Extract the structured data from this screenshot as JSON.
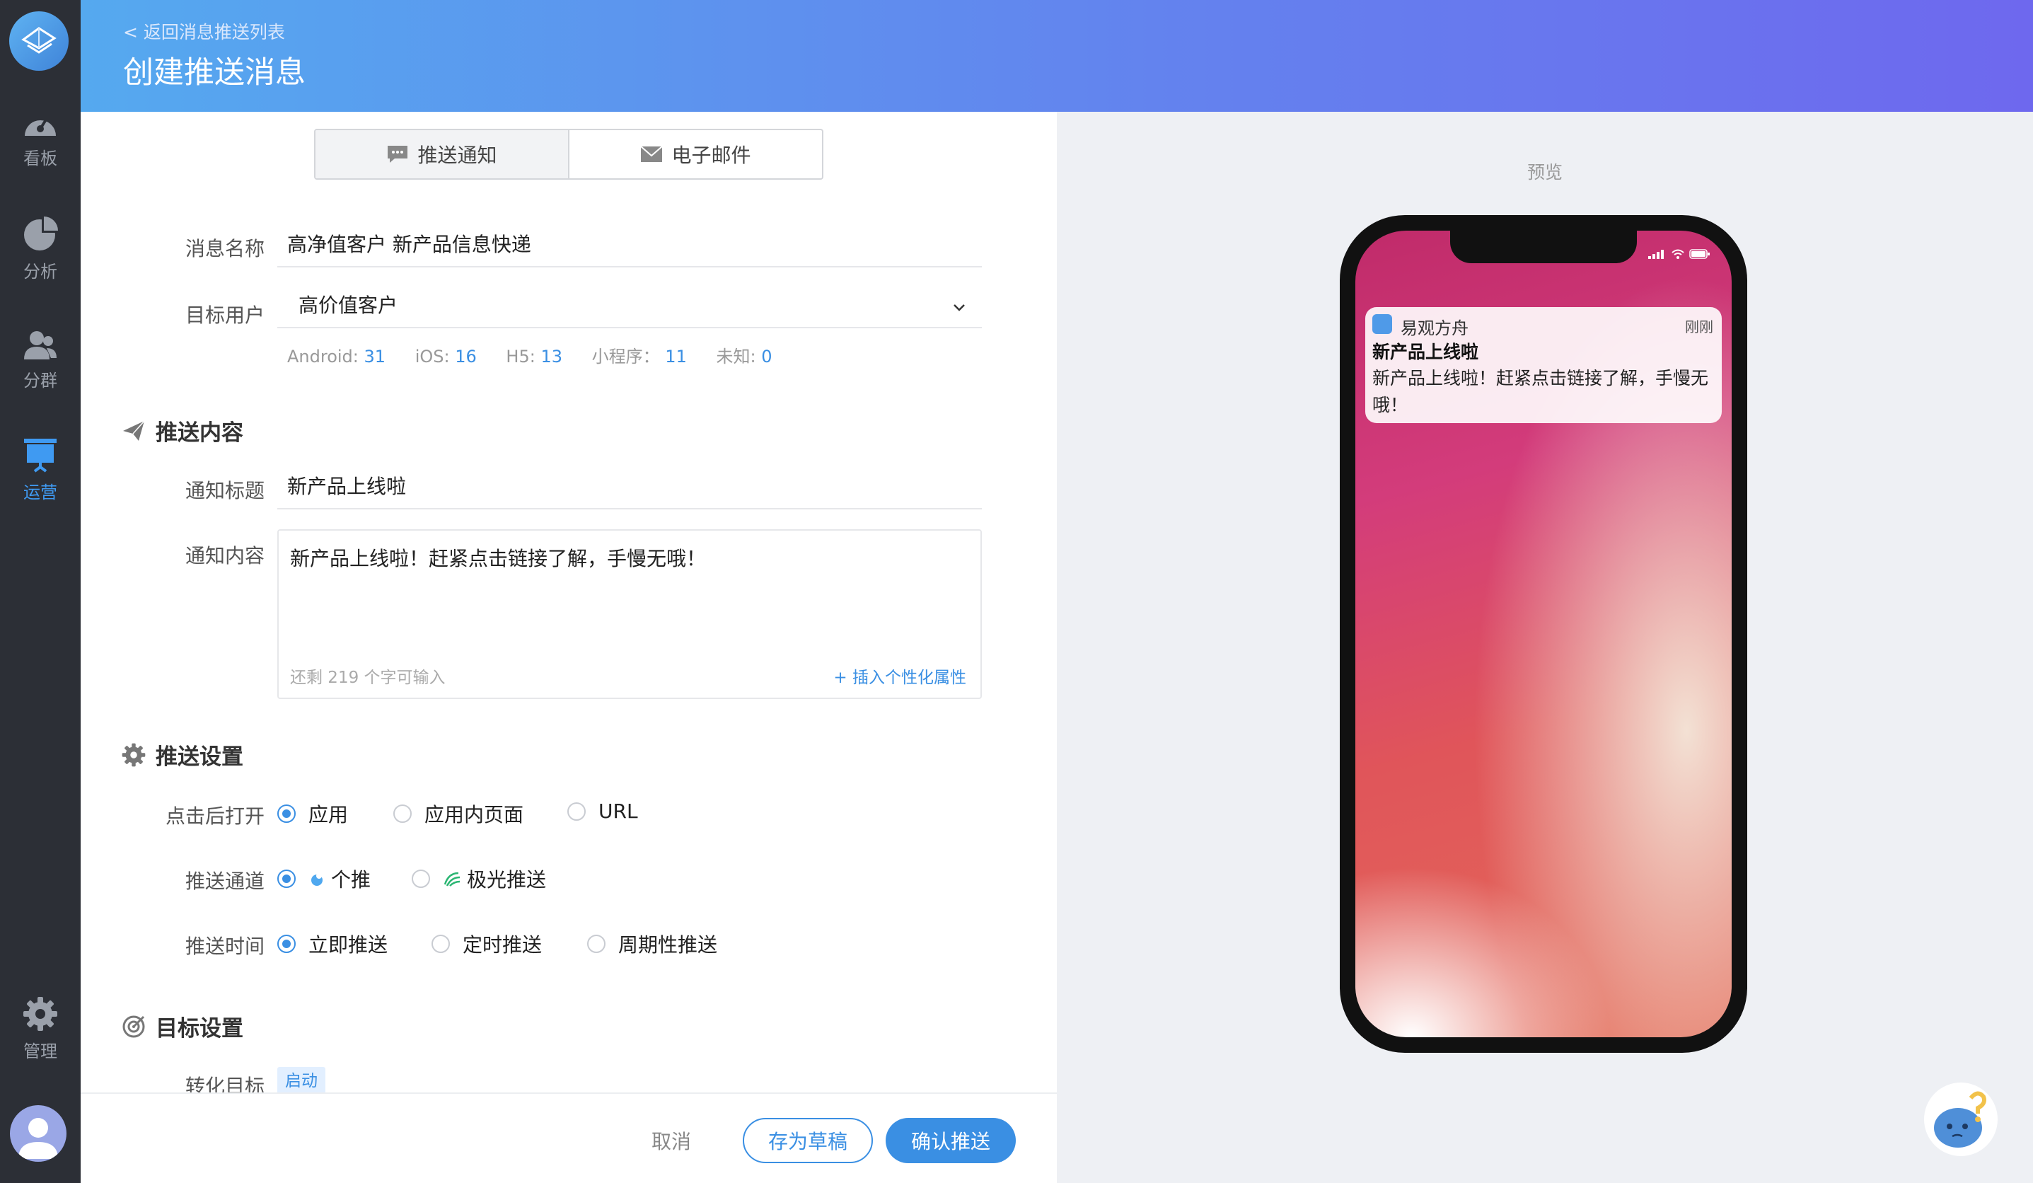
{
  "sidebar": {
    "items": [
      {
        "label": "看板",
        "icon": "dashboard-icon"
      },
      {
        "label": "分析",
        "icon": "pie-chart-icon"
      },
      {
        "label": "分群",
        "icon": "users-icon"
      },
      {
        "label": "运营",
        "icon": "presentation-icon",
        "active": true
      },
      {
        "label": "管理",
        "icon": "gear-icon"
      }
    ]
  },
  "header": {
    "back": "< 返回消息推送列表",
    "title": "创建推送消息"
  },
  "tabs": [
    "推送通知",
    "电子邮件"
  ],
  "form": {
    "message_name_label": "消息名称",
    "message_name": "高净值客户 新产品信息快递",
    "target_label": "目标用户",
    "target_value": "高价值客户",
    "stats": [
      {
        "label": "Android:",
        "value": "31"
      },
      {
        "label": "iOS:",
        "value": "16"
      },
      {
        "label": "H5:",
        "value": "13"
      },
      {
        "label": "小程序：",
        "value": "11"
      },
      {
        "label": "未知:",
        "value": "0"
      }
    ],
    "content_section": "推送内容",
    "notif_title_label": "通知标题",
    "notif_title": "新产品上线啦",
    "notif_content_label": "通知内容",
    "notif_content": "新产品上线啦！赶紧点击链接了解，手慢无哦！",
    "remaining": "还剩 219 个字可输入",
    "insert_attr": "+ 插入个性化属性",
    "settings_section": "推送设置",
    "open_label": "点击后打开",
    "open_options": [
      "应用",
      "应用内页面",
      "URL"
    ],
    "channel_label": "推送通道",
    "channel_options": [
      "个推",
      "极光推送"
    ],
    "time_label": "推送时间",
    "time_options": [
      "立即推送",
      "定时推送",
      "周期性推送"
    ],
    "goal_section": "目标设置",
    "conversion_label": "转化目标",
    "conversion_badge": "启动"
  },
  "footer": {
    "cancel": "取消",
    "draft": "存为草稿",
    "confirm": "确认推送"
  },
  "preview": {
    "label": "预览",
    "app": "易观方舟",
    "time": "刚刚",
    "title": "新产品上线啦",
    "body": "新产品上线啦！赶紧点击链接了解，手慢无哦！"
  },
  "colors": {
    "accent": "#3a8fe3",
    "sidebar": "#2c2f36"
  }
}
